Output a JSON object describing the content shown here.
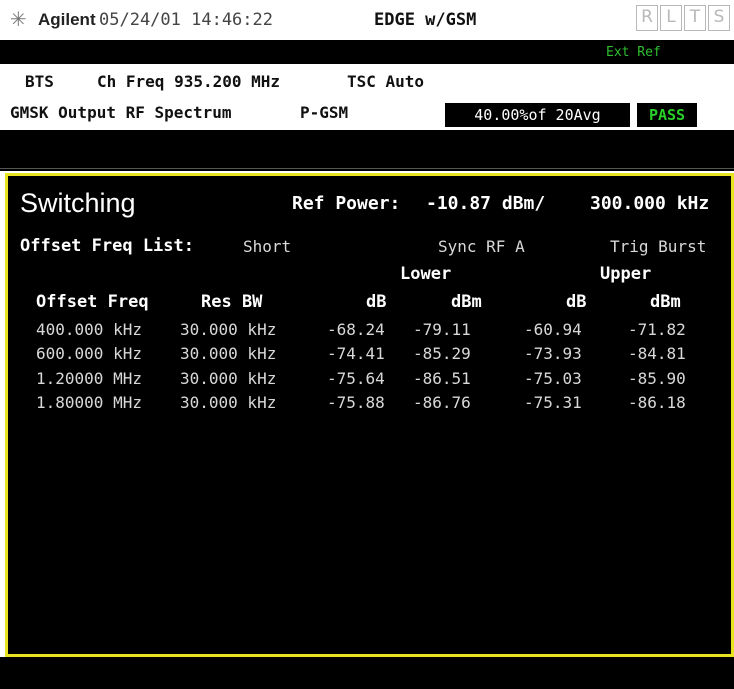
{
  "header": {
    "logo_glyph": "✳",
    "brand": "Agilent",
    "datetime": "05/24/01 14:46:22",
    "mode": "EDGE w/GSM",
    "tabs": [
      "R",
      "L",
      "T",
      "S"
    ]
  },
  "status": {
    "ext_ref": "Ext Ref"
  },
  "info": {
    "bts": "BTS",
    "ch_freq": "Ch Freq 935.200 MHz",
    "tsc": "TSC Auto",
    "measurement": "GMSK Output RF Spectrum",
    "band": "P-GSM",
    "avg_status": "40.00%of 20Avg",
    "pass": "PASS"
  },
  "panel": {
    "title": "Switching",
    "ref_power_label": "Ref Power:",
    "ref_power_value": "-10.87 dBm/",
    "ref_bw": "300.000 kHz",
    "offset_list_label": "Offset Freq List:",
    "offset_list_value": "Short",
    "sync": "Sync RF A",
    "trig": "Trig Burst",
    "lower_label": "Lower",
    "upper_label": "Upper",
    "columns": [
      "Offset Freq",
      "Res BW",
      "dB",
      "dBm",
      "dB",
      "dBm"
    ],
    "rows": [
      [
        "400.000 kHz",
        "30.000 kHz",
        "-68.24",
        "-79.11",
        "-60.94",
        "-71.82"
      ],
      [
        "600.000 kHz",
        "30.000 kHz",
        "-74.41",
        "-85.29",
        "-73.93",
        "-84.81"
      ],
      [
        "1.20000 MHz",
        "30.000 kHz",
        "-75.64",
        "-86.51",
        "-75.03",
        "-85.90"
      ],
      [
        "1.80000 MHz",
        "30.000 kHz",
        "-75.88",
        "-86.76",
        "-75.31",
        "-86.18"
      ]
    ]
  },
  "colors": {
    "frame": "#e8e21f",
    "pass": "#28d028",
    "ext_ref": "#2fbf2f",
    "background": "#000000"
  }
}
